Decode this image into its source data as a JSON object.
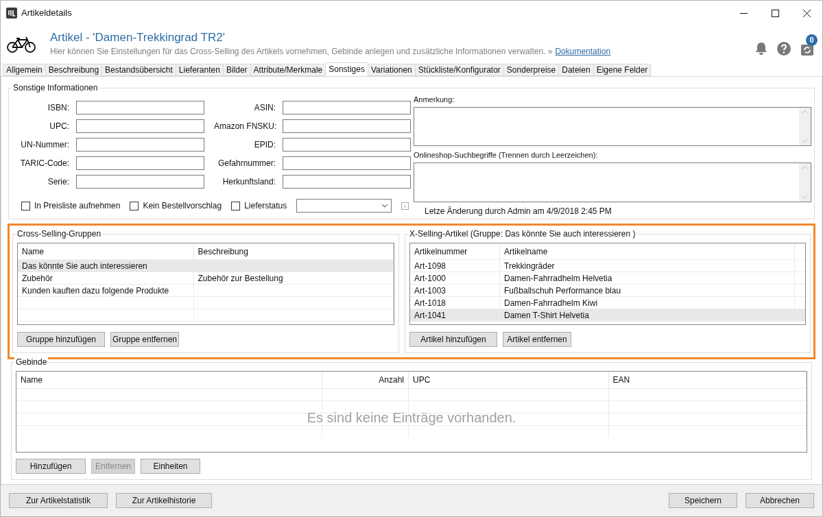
{
  "window": {
    "title": "Artikeldetails"
  },
  "header": {
    "title": "Artikel - 'Damen-Trekkingrad TR2'",
    "description": "Hier können Sie Einstellungen für das Cross-Selling des Artikels vornehmen, Gebinde anlegen und zusätzliche Informationen verwalten. »",
    "link": "Dokumentation",
    "sync_badge": "0"
  },
  "tabs": [
    {
      "label": "Allgemein",
      "selected": false
    },
    {
      "label": "Beschreibung",
      "selected": false
    },
    {
      "label": "Bestandsübersicht",
      "selected": false
    },
    {
      "label": "Lieferanten",
      "selected": false
    },
    {
      "label": "Bilder",
      "selected": false
    },
    {
      "label": "Attribute/Merkmale",
      "selected": false
    },
    {
      "label": "Sonstiges",
      "selected": true
    },
    {
      "label": "Variationen",
      "selected": false
    },
    {
      "label": "Stückliste/Konfigurator",
      "selected": false
    },
    {
      "label": "Sonderpreise",
      "selected": false
    },
    {
      "label": "Dateien",
      "selected": false
    },
    {
      "label": "Eigene Felder",
      "selected": false
    }
  ],
  "sonstige": {
    "title": "Sonstige Informationen",
    "left_fields": [
      {
        "label": "ISBN:"
      },
      {
        "label": "UPC:"
      },
      {
        "label": "UN-Nummer:"
      },
      {
        "label": "TARIC-Code:"
      },
      {
        "label": "Serie:"
      }
    ],
    "right_fields": [
      {
        "label": "ASIN:"
      },
      {
        "label": "Amazon FNSKU:"
      },
      {
        "label": "EPID:"
      },
      {
        "label": "Gefahrnummer:"
      },
      {
        "label": "Herkunftsland:"
      }
    ],
    "checkboxes": [
      {
        "label": "In Preisliste aufnehmen",
        "checked": false
      },
      {
        "label": "Kein Bestellvorschlag",
        "checked": false
      },
      {
        "label": "Lieferstatus",
        "checked": false
      }
    ],
    "note_label": "Anmerkung:",
    "search_terms_label": "Onlineshop-Suchbegriffe (Trennen durch Leerzeichen):",
    "last_change": "Letze Änderung durch Admin am 4/9/2018 2:45 PM"
  },
  "cross_selling": {
    "title": "Cross-Selling-Gruppen",
    "columns": [
      "Name",
      "Beschreibung"
    ],
    "rows": [
      {
        "cells": [
          "Das könnte Sie auch interessieren",
          ""
        ],
        "selected": true
      },
      {
        "cells": [
          "Zubehör",
          "Zubehör zur Bestellung"
        ],
        "selected": false
      },
      {
        "cells": [
          "Kunden kauften dazu folgende Produkte",
          ""
        ],
        "selected": false
      }
    ],
    "buttons": [
      "Gruppe hinzufügen",
      "Gruppe entfernen"
    ]
  },
  "x_selling": {
    "title": "X-Selling-Artikel (Gruppe: Das könnte Sie auch interessieren )",
    "columns": [
      "Artikelnummer",
      "Artikelname"
    ],
    "rows": [
      {
        "cells": [
          "Art-1098",
          "Trekkingräder"
        ],
        "selected": false
      },
      {
        "cells": [
          "Art-1000",
          "Damen-Fahrradhelm Helvetia"
        ],
        "selected": false
      },
      {
        "cells": [
          "Art-1003",
          "Fußballschuh Performance blau"
        ],
        "selected": false
      },
      {
        "cells": [
          "Art-1018",
          "Damen-Fahrradhelm Kiwi"
        ],
        "selected": false
      },
      {
        "cells": [
          "Art-1041",
          "Damen T-Shirt Helvetia"
        ],
        "selected": true
      }
    ],
    "buttons": [
      "Artikel hinzufügen",
      "Artikel entfernen"
    ]
  },
  "gebinde": {
    "title": "Gebinde",
    "columns": [
      "Name",
      "Anzahl",
      "UPC",
      "EAN"
    ],
    "empty_message": "Es sind keine Einträge vorhanden.",
    "buttons": [
      {
        "label": "Hinzufügen",
        "disabled": false
      },
      {
        "label": "Entfernen",
        "disabled": true
      },
      {
        "label": "Einheiten",
        "disabled": false
      }
    ]
  },
  "footer": {
    "left_buttons": [
      "Zur Artikelstatistik",
      "Zur Artikelhistorie"
    ],
    "right_buttons": [
      "Speichern",
      "Abbrechen"
    ]
  }
}
